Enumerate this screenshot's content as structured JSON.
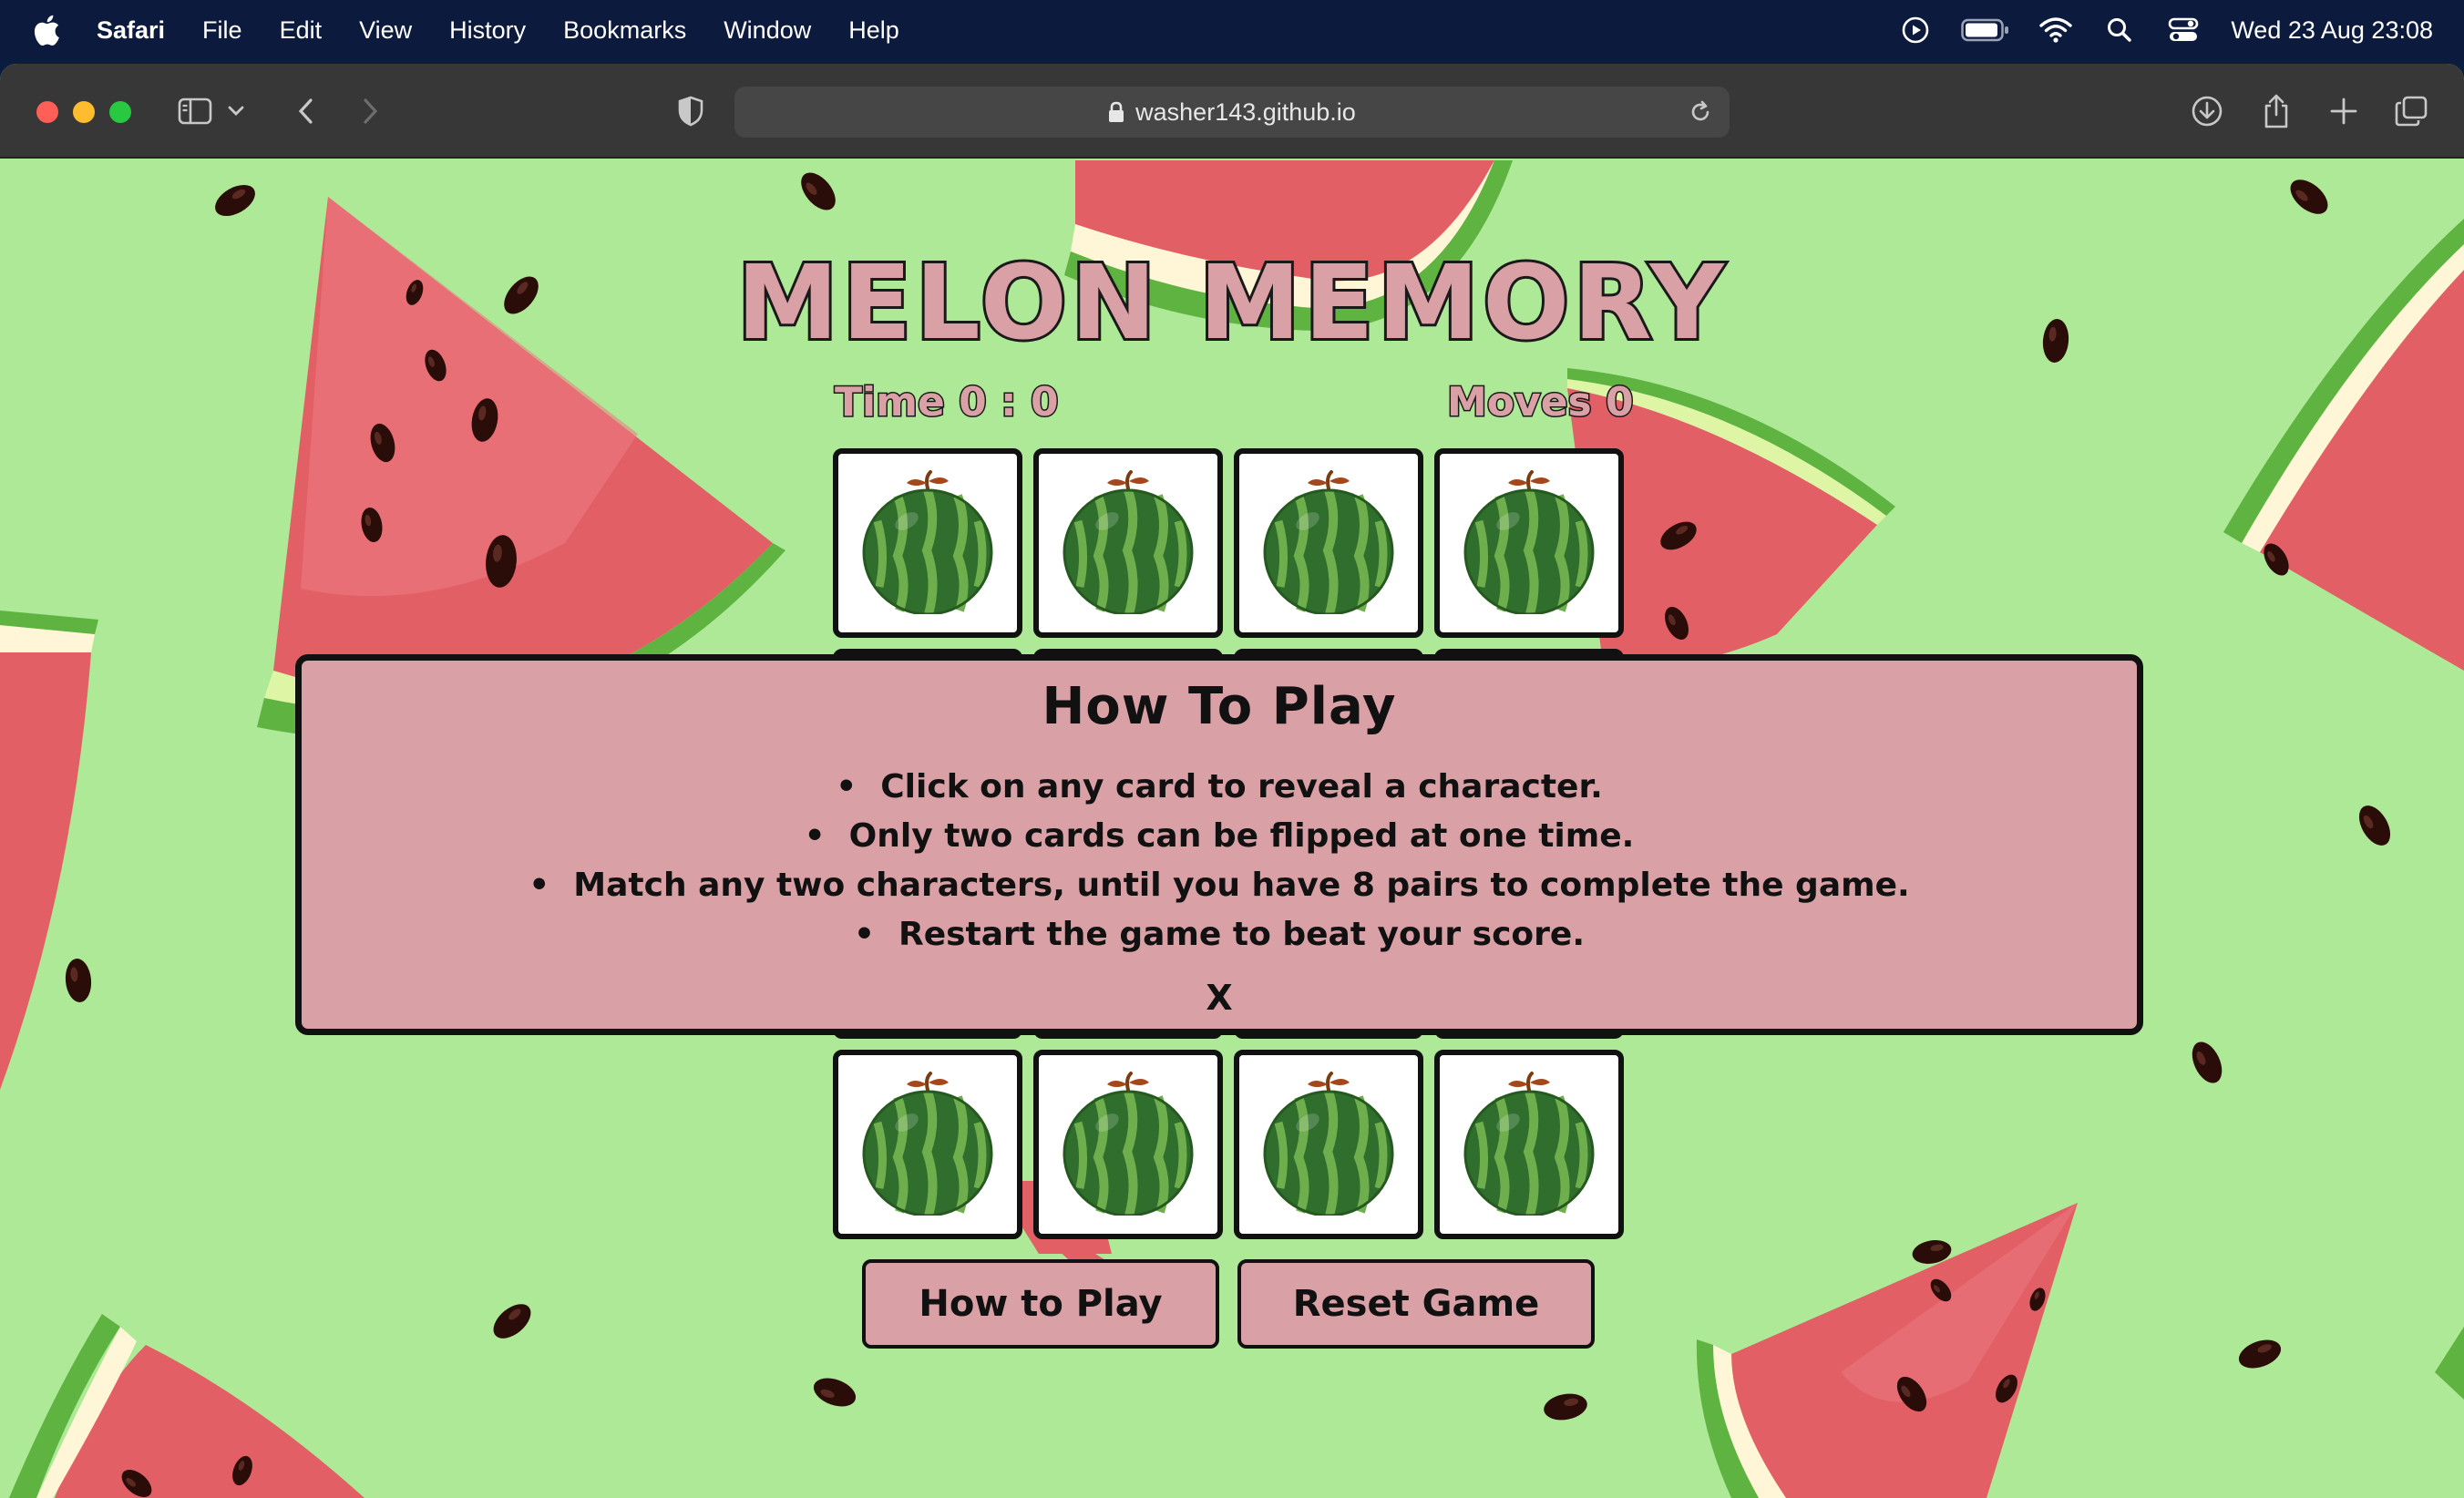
{
  "menubar": {
    "app": "Safari",
    "items": [
      "File",
      "Edit",
      "View",
      "History",
      "Bookmarks",
      "Window",
      "Help"
    ],
    "clock": "Wed 23 Aug  23:08",
    "status_icons": [
      "play-circle-icon",
      "battery-icon",
      "wifi-icon",
      "spotlight-search-icon",
      "control-center-icon"
    ]
  },
  "browser": {
    "url": "washer143.github.io",
    "toolbar_icons": [
      "sidebar-icon",
      "chevron-down-icon",
      "back-icon",
      "forward-icon",
      "privacy-shield-icon",
      "download-icon",
      "share-icon",
      "new-tab-icon",
      "tab-overview-icon"
    ]
  },
  "game": {
    "title": "MELON MEMORY",
    "time_label": "Time 0 : 0",
    "moves_label": "Moves 0",
    "card_back": "watermelon-icon",
    "buttons": {
      "how_to_play": "How to Play",
      "reset": "Reset Game"
    }
  },
  "modal": {
    "title": "How To Play",
    "rules": [
      "Click on any card to reveal a character.",
      "Only two cards can be flipped at one time.",
      "Match any two characters, until you have 8 pairs to complete the game.",
      "Restart the game to beat your score."
    ],
    "close": "X"
  },
  "colors": {
    "background": "#ade996",
    "accent_pink": "#d9a0a5",
    "melon_red": "#e35f66",
    "rind_green": "#5fb341"
  }
}
